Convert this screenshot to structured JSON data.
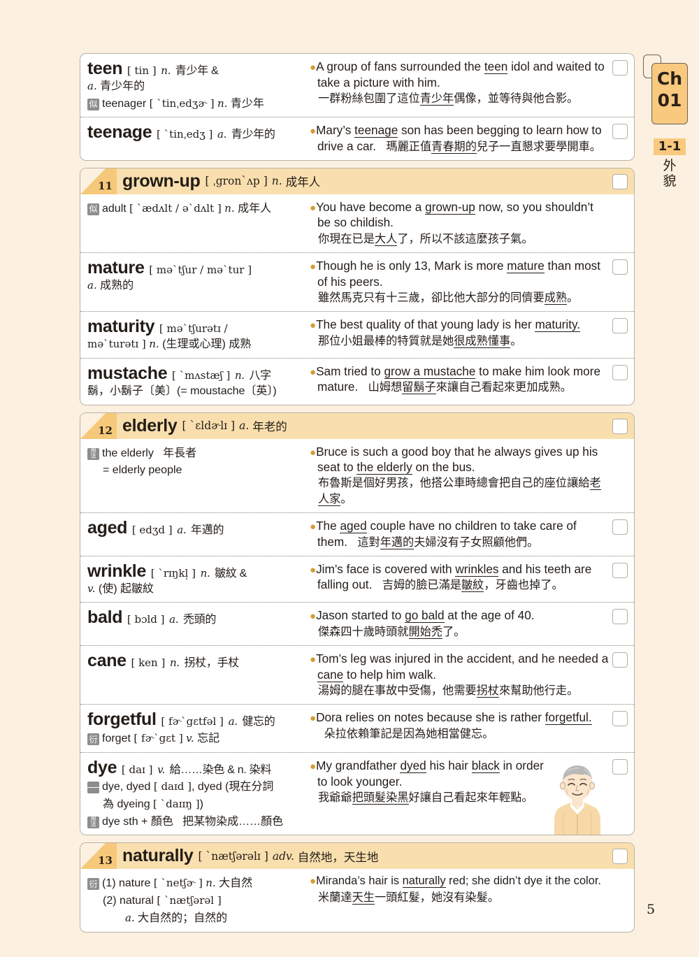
{
  "page": {
    "page_number": "5",
    "background_color": "#fcf1e0",
    "card_color": "#ffffff",
    "header_band_color": "#f9dfae",
    "badge_color": "#f6c97a",
    "accent_bullet_color": "#d59b32"
  },
  "side_tab": {
    "chapter_line1": "Ch",
    "chapter_line2": "01",
    "section": "1-1",
    "section_label_line1": "外",
    "section_label_line2": "貌"
  },
  "blocks": [
    {
      "type": "plain",
      "entries": [
        {
          "headword": "teen",
          "phonetic": "[ tin ]",
          "pos": "n.",
          "definition": "青少年 &",
          "continued": "a. 青少年的",
          "notes": [
            {
              "icon": "似",
              "icon_type": "single",
              "text": "teenager [ ˋtinˌedʒɚ ] n. 青少年"
            }
          ],
          "example_en_pre": "A group of fans surrounded the ",
          "example_en_underline": "teen",
          "example_en_post": " idol and waited to take a picture with him.",
          "example_zh_pre": "一群粉絲包圍了這位",
          "example_zh_underline": "青少年",
          "example_zh_post": "偶像，並等待與他合影。",
          "zh_on_new_line": true
        },
        {
          "headword": "teenage",
          "phonetic": "[ ˋtinˌedʒ ]",
          "pos": "a.",
          "definition": "青少年的",
          "continued": "",
          "notes": [],
          "example_en_pre": "Mary’s ",
          "example_en_underline": "teenage",
          "example_en_post": " son has been begging to learn how to drive a car.",
          "example_zh_pre": "瑪麗正值",
          "example_zh_underline": "青春期的",
          "example_zh_post": "兒子一直懇求要學開車。",
          "zh_on_new_line": false
        }
      ]
    },
    {
      "type": "group",
      "number": "11",
      "header": {
        "word": "grown-up",
        "phonetic": "[ ˌgronˋʌp ]",
        "pos": "n.",
        "definition": "成年人"
      },
      "entries": [
        {
          "headword": "",
          "phonetic": "",
          "pos": "",
          "definition": "",
          "continued": "",
          "notes": [
            {
              "icon": "似",
              "icon_type": "single",
              "text": "adult [ ˋædʌlt / əˋdʌlt ] n. 成年人"
            }
          ],
          "example_en_pre": "You have become a ",
          "example_en_underline": "grown-up",
          "example_en_post": " now, so you shouldn’t be so childish.",
          "example_zh_pre": "你現在已是",
          "example_zh_underline": "大人",
          "example_zh_post": "了，所以不該這麼孩子氣。",
          "zh_on_new_line": true
        },
        {
          "headword": "mature",
          "phonetic": "[ məˋtʃur / məˋtur ]",
          "pos": "",
          "definition": "",
          "continued": "a. 成熟的",
          "notes": [],
          "example_en_pre": "Though he is only 13, Mark is more ",
          "example_en_underline": "mature",
          "example_en_post": " than most of his peers.",
          "example_zh_pre": "雖然馬克只有十三歲，卻比他大部分的同儕要",
          "example_zh_underline": "成熟",
          "example_zh_post": "。",
          "zh_on_new_line": true
        },
        {
          "headword": "maturity",
          "phonetic": "[ məˋtʃurətɪ /",
          "pos": "",
          "definition": "",
          "continued": "məˋturətɪ ] n. (生理或心理) 成熟",
          "notes": [],
          "example_en_pre": "The best quality of that young lady is her ",
          "example_en_underline": "maturity.",
          "example_en_post": "",
          "example_zh_pre": "那位小姐最棒的特質就是她",
          "example_zh_underline": "很成熟懂事",
          "example_zh_post": "。",
          "zh_on_new_line": true
        },
        {
          "headword": "mustache",
          "phonetic": "[ ˋmʌstæʃ ]",
          "pos": "n.",
          "definition": "八字",
          "continued": "鬍，小鬍子〔美〕(= moustache〔英〕)",
          "notes": [],
          "example_en_pre": "Sam tried to ",
          "example_en_underline": "grow a mustache",
          "example_en_post": " to make him look more mature.",
          "example_zh_pre": "山姆想",
          "example_zh_underline": "留鬍子",
          "example_zh_post": "來讓自己看起來更加成熟。",
          "zh_on_new_line": false
        }
      ]
    },
    {
      "type": "group",
      "number": "12",
      "header": {
        "word": "elderly",
        "phonetic": "[ ˋɛldɚlɪ ]",
        "pos": "a.",
        "definition": "年老的"
      },
      "entries": [
        {
          "headword": "",
          "phonetic": "",
          "pos": "",
          "definition": "",
          "continued": "",
          "notes": [
            {
              "icon": "用法",
              "icon_type": "double",
              "text": "the elderly　年長者"
            },
            {
              "icon": "",
              "icon_type": "indent",
              "text": "= elderly people"
            }
          ],
          "example_en_pre": "Bruce is such a good boy that he always gives up his seat to ",
          "example_en_underline": "the elderly",
          "example_en_post": " on the bus.",
          "example_zh_pre": "布魯斯是個好男孩，他搭公車時總會把自己的座位讓給",
          "example_zh_underline": "老人家",
          "example_zh_post": "。",
          "zh_on_new_line": true,
          "no_checkbox": true
        },
        {
          "headword": "aged",
          "phonetic": "[ edʒd ]",
          "pos": "a.",
          "definition": "年邁的",
          "continued": "",
          "notes": [],
          "example_en_pre": "The ",
          "example_en_underline": "aged",
          "example_en_post": " couple have no children to take care of them.",
          "example_zh_pre": "這對",
          "example_zh_underline": "年邁的",
          "example_zh_post": "夫婦沒有子女照顧他們。",
          "zh_on_new_line": false
        },
        {
          "headword": "wrinkle",
          "phonetic": "[ ˋrɪŋkl̩ ]",
          "pos": "n.",
          "definition": "皺紋 &",
          "continued": "v. (使) 起皺紋",
          "notes": [],
          "example_en_pre": "Jim’s face is covered with ",
          "example_en_underline": "wrinkles",
          "example_en_post": " and his teeth are falling out.",
          "example_zh_pre": "吉姆的臉已滿是",
          "example_zh_underline": "皺紋",
          "example_zh_post": "，牙齒也掉了。",
          "zh_on_new_line": false
        },
        {
          "headword": "bald",
          "phonetic": "[ bɔld ]",
          "pos": "a.",
          "definition": "禿頭的",
          "continued": "",
          "notes": [],
          "example_en_pre": "Jason started to ",
          "example_en_underline": "go bald",
          "example_en_post": " at the age of 40.",
          "example_zh_pre": "傑森四十歲時頭就",
          "example_zh_underline": "開始禿",
          "example_zh_post": "了。",
          "zh_on_new_line": true
        },
        {
          "headword": "cane",
          "phonetic": "[ ken ]",
          "pos": "n.",
          "definition": "拐杖，手杖",
          "continued": "",
          "notes": [],
          "example_en_pre": "Tom’s leg was injured in the accident, and he needed a ",
          "example_en_underline": "cane",
          "example_en_post": " to help him walk.",
          "example_zh_pre": "湯姆的腿在事故中受傷，他需要",
          "example_zh_underline": "拐杖",
          "example_zh_post": "來幫助他行走。",
          "zh_on_new_line": true
        },
        {
          "headword": "forgetful",
          "phonetic": "[ fɚˋgɛtfəl ]",
          "pos": "a.",
          "definition": "健忘的",
          "continued": "",
          "notes": [
            {
              "icon": "衍",
              "icon_type": "single",
              "text": "forget [ fɚˋgɛt ] v. 忘記"
            }
          ],
          "example_en_pre": "Dora relies on notes because she is rather ",
          "example_en_underline": "forgetful.",
          "example_en_post": "",
          "example_zh_pre": "朵拉依賴筆記是因為她相當健忘。",
          "example_zh_underline": "",
          "example_zh_post": "",
          "zh_on_new_line": false
        },
        {
          "headword": "dye",
          "phonetic": "[ daɪ ]",
          "pos": "v.",
          "definition": "給……染色 & n. 染料",
          "continued": "",
          "notes": [
            {
              "icon": "lines",
              "icon_type": "lines",
              "text": "dye, dyed [ daɪd ], dyed (現在分詞"
            },
            {
              "icon": "",
              "icon_type": "indent",
              "text": "為 dyeing [ ˋdaɪɪŋ ])"
            },
            {
              "icon": "用法",
              "icon_type": "double",
              "text": "dye sth + 顏色　把某物染成……顏色"
            }
          ],
          "example_en_pre": "My grandfather ",
          "example_en_underline": "dyed",
          "example_en_post": " his hair ",
          "example_en_underline2": "black",
          "example_en_post2": " in order to look younger.",
          "example_zh_pre": "我爺爺",
          "example_zh_underline": "把頭髮",
          "example_zh_mid": "",
          "example_zh_underline2": "染黑",
          "example_zh_post": "好讓自己看起來年輕點。",
          "zh_on_new_line": true,
          "has_illustration": true,
          "illustration_name": "elderly-man-illustration"
        }
      ]
    },
    {
      "type": "group",
      "number": "13",
      "header": {
        "word": "naturally",
        "phonetic": "[ ˋnætʃərəlɪ ]",
        "pos": "adv.",
        "definition": "自然地，天生地"
      },
      "entries": [
        {
          "headword": "",
          "phonetic": "",
          "pos": "",
          "definition": "",
          "continued": "",
          "notes": [
            {
              "icon": "衍",
              "icon_type": "single",
              "text": "(1) nature [ ˋnetʃɚ ] n. 大自然"
            },
            {
              "icon": "",
              "icon_type": "indent",
              "text": "(2) natural [ ˋnætʃərəl ]"
            },
            {
              "icon": "",
              "icon_type": "indent2",
              "text": "a. 大自然的；自然的"
            }
          ],
          "example_en_pre": "Miranda’s hair is ",
          "example_en_underline": "naturally",
          "example_en_post": " red; she didn’t dye it the color.",
          "example_zh_pre": "米蘭達",
          "example_zh_underline": "天生",
          "example_zh_post": "一頭紅髮，她沒有染髮。",
          "zh_on_new_line": true,
          "no_checkbox": true,
          "small_text": true
        }
      ]
    }
  ]
}
